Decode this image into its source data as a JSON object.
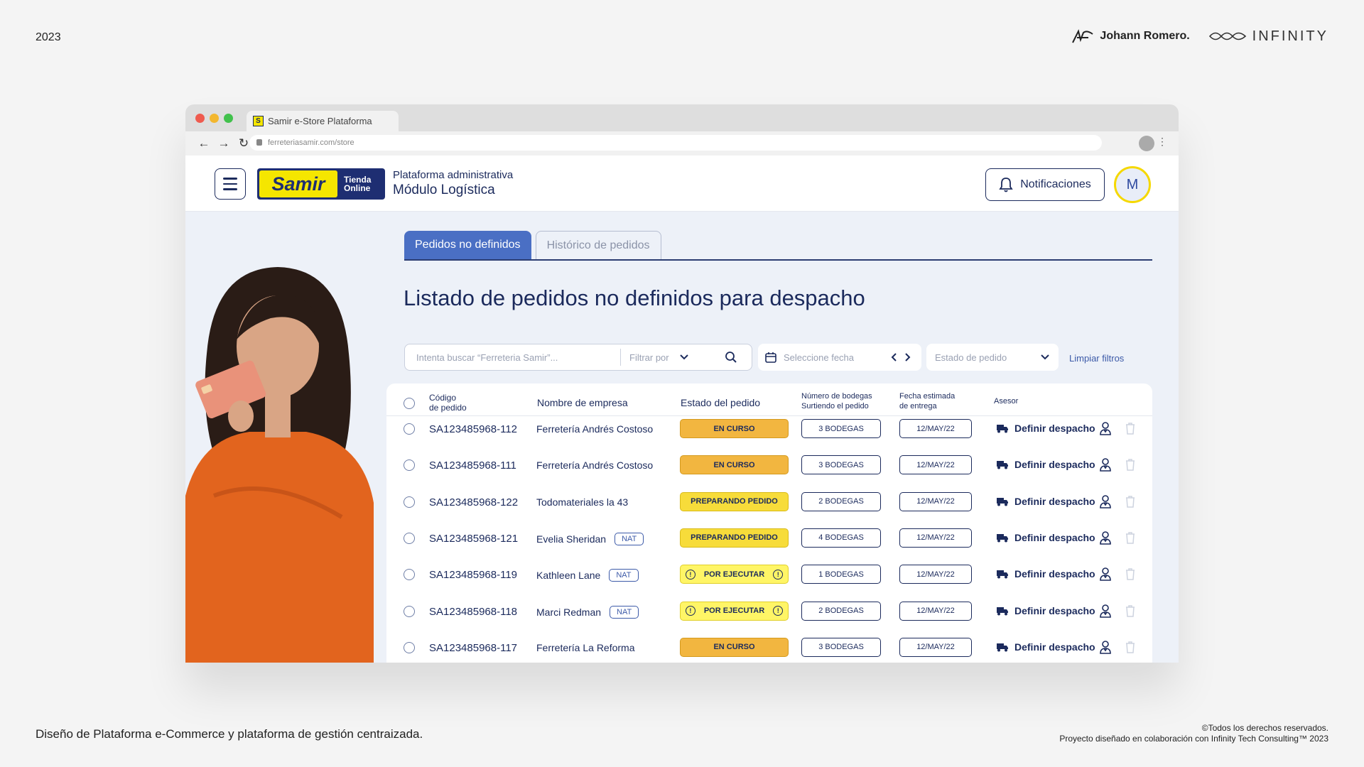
{
  "page": {
    "year": "2023",
    "author": "Johann Romero.",
    "partner": "INFINITY",
    "footer_left": "Diseño de Plataforma e-Commerce y plataforma de gestión centraizada.",
    "footer_right_1": "©Todos los derechos reservados.",
    "footer_right_2": "Proyecto diseñado en colaboración con Infinity Tech Consulting™ 2023"
  },
  "browser": {
    "tab_title": "Samir e-Store Plataforma",
    "url": "ferreteriasamir.com/store"
  },
  "header": {
    "logo_text": "Samir",
    "logo_sub_1": "Tienda",
    "logo_sub_2": "Online",
    "title": "Plataforma administrativa",
    "subtitle": "Módulo Logística",
    "notifications_label": "Notificaciones",
    "avatar_initial": "M"
  },
  "tabs": [
    {
      "label": "Pedidos no definidos"
    },
    {
      "label": "Histórico de pedidos"
    }
  ],
  "heading": "Listado de pedidos no definidos para despacho",
  "filters": {
    "search_placeholder": "Intenta buscar “Ferreteria Samir”...",
    "filter_by": "Filtrar por",
    "date_placeholder": "Seleccione fecha",
    "status_placeholder": "Estado de pedido",
    "clear": "Limpiar filtros"
  },
  "table": {
    "headers": {
      "code_1": "Código",
      "code_2": "de pedido",
      "company": "Nombre de empresa",
      "status": "Estado del pedido",
      "warehouses_1": "Número de bodegas",
      "warehouses_2": "Surtiendo el pedido",
      "date_1": "Fecha estimada",
      "date_2": "de entrega",
      "advisor": "Asesor"
    },
    "action_label": "Definir despacho",
    "rows": [
      {
        "code": "SA123485968-112",
        "company": "Ferretería Andrés Costoso",
        "nat": "",
        "status": "EN CURSO",
        "kind": "curso",
        "warehouses": "3 BODEGAS",
        "date": "12/MAY/22"
      },
      {
        "code": "SA123485968-111",
        "company": "Ferretería Andrés Costoso",
        "nat": "",
        "status": "EN CURSO",
        "kind": "curso",
        "warehouses": "3 BODEGAS",
        "date": "12/MAY/22"
      },
      {
        "code": "SA123485968-122",
        "company": "Todomateriales la 43",
        "nat": "",
        "status": "PREPARANDO PEDIDO",
        "kind": "prep",
        "warehouses": "2 BODEGAS",
        "date": "12/MAY/22"
      },
      {
        "code": "SA123485968-121",
        "company": "Evelia Sheridan",
        "nat": "NAT",
        "status": "PREPARANDO PEDIDO",
        "kind": "prep",
        "warehouses": "4 BODEGAS",
        "date": "12/MAY/22"
      },
      {
        "code": "SA123485968-119",
        "company": "Kathleen Lane",
        "nat": "NAT",
        "status": "POR EJECUTAR",
        "kind": "por",
        "warehouses": "1 BODEGAS",
        "date": "12/MAY/22"
      },
      {
        "code": "SA123485968-118",
        "company": "Marci Redman",
        "nat": "NAT",
        "status": "POR EJECUTAR",
        "kind": "por",
        "warehouses": "2 BODEGAS",
        "date": "12/MAY/22"
      },
      {
        "code": "SA123485968-117",
        "company": "Ferretería La Reforma",
        "nat": "",
        "status": "EN CURSO",
        "kind": "curso",
        "warehouses": "3 BODEGAS",
        "date": "12/MAY/22"
      }
    ]
  },
  "colors": {
    "primary": "#1b2a5c",
    "accent": "#4a6fc4",
    "brand_yellow": "#f5e600",
    "status_en_curso": "#f2b640",
    "status_preparando": "#f7dc3a",
    "status_por_ejecutar": "#fff566"
  }
}
